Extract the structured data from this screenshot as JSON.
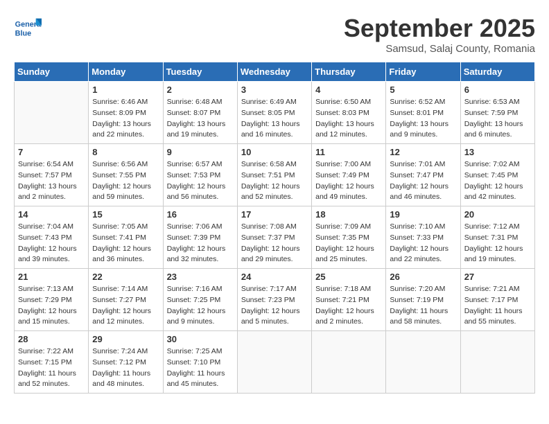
{
  "logo": {
    "text_general": "General",
    "text_blue": "Blue"
  },
  "header": {
    "month": "September 2025",
    "location": "Samsud, Salaj County, Romania"
  },
  "weekdays": [
    "Sunday",
    "Monday",
    "Tuesday",
    "Wednesday",
    "Thursday",
    "Friday",
    "Saturday"
  ],
  "weeks": [
    [
      {
        "day": "",
        "info": ""
      },
      {
        "day": "1",
        "info": "Sunrise: 6:46 AM\nSunset: 8:09 PM\nDaylight: 13 hours\nand 22 minutes."
      },
      {
        "day": "2",
        "info": "Sunrise: 6:48 AM\nSunset: 8:07 PM\nDaylight: 13 hours\nand 19 minutes."
      },
      {
        "day": "3",
        "info": "Sunrise: 6:49 AM\nSunset: 8:05 PM\nDaylight: 13 hours\nand 16 minutes."
      },
      {
        "day": "4",
        "info": "Sunrise: 6:50 AM\nSunset: 8:03 PM\nDaylight: 13 hours\nand 12 minutes."
      },
      {
        "day": "5",
        "info": "Sunrise: 6:52 AM\nSunset: 8:01 PM\nDaylight: 13 hours\nand 9 minutes."
      },
      {
        "day": "6",
        "info": "Sunrise: 6:53 AM\nSunset: 7:59 PM\nDaylight: 13 hours\nand 6 minutes."
      }
    ],
    [
      {
        "day": "7",
        "info": "Sunrise: 6:54 AM\nSunset: 7:57 PM\nDaylight: 13 hours\nand 2 minutes."
      },
      {
        "day": "8",
        "info": "Sunrise: 6:56 AM\nSunset: 7:55 PM\nDaylight: 12 hours\nand 59 minutes."
      },
      {
        "day": "9",
        "info": "Sunrise: 6:57 AM\nSunset: 7:53 PM\nDaylight: 12 hours\nand 56 minutes."
      },
      {
        "day": "10",
        "info": "Sunrise: 6:58 AM\nSunset: 7:51 PM\nDaylight: 12 hours\nand 52 minutes."
      },
      {
        "day": "11",
        "info": "Sunrise: 7:00 AM\nSunset: 7:49 PM\nDaylight: 12 hours\nand 49 minutes."
      },
      {
        "day": "12",
        "info": "Sunrise: 7:01 AM\nSunset: 7:47 PM\nDaylight: 12 hours\nand 46 minutes."
      },
      {
        "day": "13",
        "info": "Sunrise: 7:02 AM\nSunset: 7:45 PM\nDaylight: 12 hours\nand 42 minutes."
      }
    ],
    [
      {
        "day": "14",
        "info": "Sunrise: 7:04 AM\nSunset: 7:43 PM\nDaylight: 12 hours\nand 39 minutes."
      },
      {
        "day": "15",
        "info": "Sunrise: 7:05 AM\nSunset: 7:41 PM\nDaylight: 12 hours\nand 36 minutes."
      },
      {
        "day": "16",
        "info": "Sunrise: 7:06 AM\nSunset: 7:39 PM\nDaylight: 12 hours\nand 32 minutes."
      },
      {
        "day": "17",
        "info": "Sunrise: 7:08 AM\nSunset: 7:37 PM\nDaylight: 12 hours\nand 29 minutes."
      },
      {
        "day": "18",
        "info": "Sunrise: 7:09 AM\nSunset: 7:35 PM\nDaylight: 12 hours\nand 25 minutes."
      },
      {
        "day": "19",
        "info": "Sunrise: 7:10 AM\nSunset: 7:33 PM\nDaylight: 12 hours\nand 22 minutes."
      },
      {
        "day": "20",
        "info": "Sunrise: 7:12 AM\nSunset: 7:31 PM\nDaylight: 12 hours\nand 19 minutes."
      }
    ],
    [
      {
        "day": "21",
        "info": "Sunrise: 7:13 AM\nSunset: 7:29 PM\nDaylight: 12 hours\nand 15 minutes."
      },
      {
        "day": "22",
        "info": "Sunrise: 7:14 AM\nSunset: 7:27 PM\nDaylight: 12 hours\nand 12 minutes."
      },
      {
        "day": "23",
        "info": "Sunrise: 7:16 AM\nSunset: 7:25 PM\nDaylight: 12 hours\nand 9 minutes."
      },
      {
        "day": "24",
        "info": "Sunrise: 7:17 AM\nSunset: 7:23 PM\nDaylight: 12 hours\nand 5 minutes."
      },
      {
        "day": "25",
        "info": "Sunrise: 7:18 AM\nSunset: 7:21 PM\nDaylight: 12 hours\nand 2 minutes."
      },
      {
        "day": "26",
        "info": "Sunrise: 7:20 AM\nSunset: 7:19 PM\nDaylight: 11 hours\nand 58 minutes."
      },
      {
        "day": "27",
        "info": "Sunrise: 7:21 AM\nSunset: 7:17 PM\nDaylight: 11 hours\nand 55 minutes."
      }
    ],
    [
      {
        "day": "28",
        "info": "Sunrise: 7:22 AM\nSunset: 7:15 PM\nDaylight: 11 hours\nand 52 minutes."
      },
      {
        "day": "29",
        "info": "Sunrise: 7:24 AM\nSunset: 7:12 PM\nDaylight: 11 hours\nand 48 minutes."
      },
      {
        "day": "30",
        "info": "Sunrise: 7:25 AM\nSunset: 7:10 PM\nDaylight: 11 hours\nand 45 minutes."
      },
      {
        "day": "",
        "info": ""
      },
      {
        "day": "",
        "info": ""
      },
      {
        "day": "",
        "info": ""
      },
      {
        "day": "",
        "info": ""
      }
    ]
  ]
}
